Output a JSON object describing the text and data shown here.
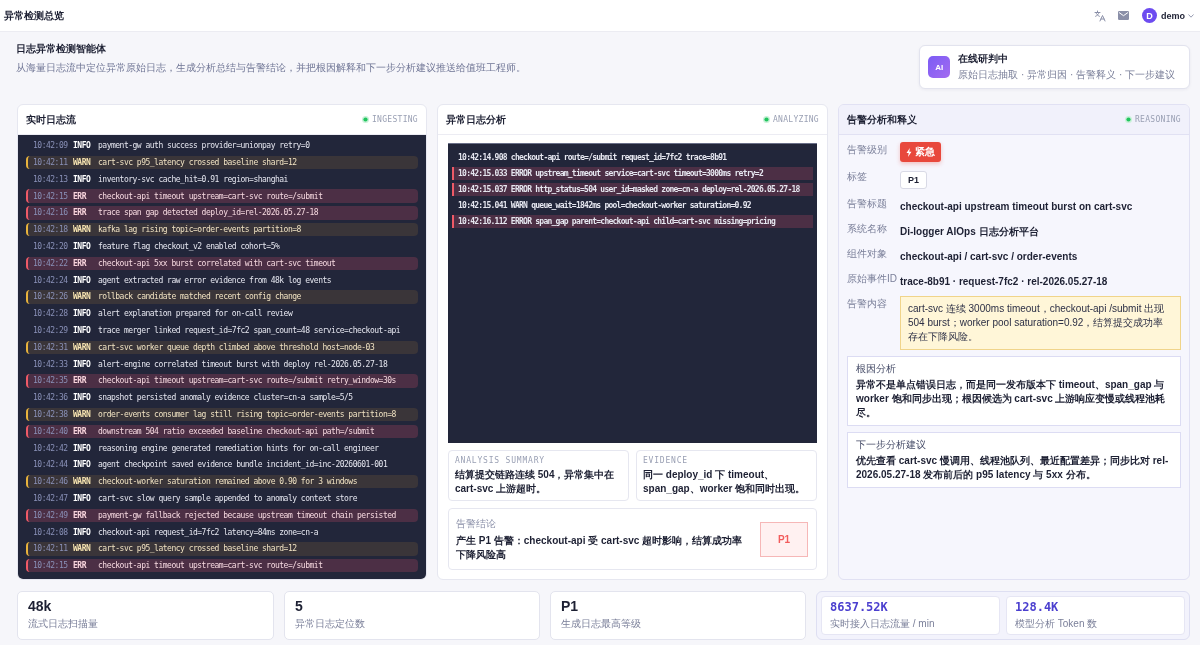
{
  "header": {
    "title": "异常检测总览",
    "user": {
      "initial": "D",
      "name": "demo"
    }
  },
  "intro": {
    "title": "日志异常检测智能体",
    "subtitle": "从海量日志流中定位异常原始日志，生成分析总结与告警结论，并把根因解释和下一步分析建议推送给值班工程师。",
    "agent_card": {
      "badge": "AI",
      "title": "在线研判中",
      "steps": "原始日志抽取 · 异常归因 · 告警释义 · 下一步建议"
    }
  },
  "log_stream": {
    "title": "实时日志流",
    "status": "INGESTING",
    "rows": [
      {
        "time": "10:42:09",
        "level": "INFO",
        "message": "payment-gw auth success provider=unionpay retry=0",
        "kind": "info"
      },
      {
        "time": "10:42:11",
        "level": "WARN",
        "message": "cart-svc p95_latency crossed baseline shard=12",
        "kind": "warn"
      },
      {
        "time": "10:42:13",
        "level": "INFO",
        "message": "inventory-svc cache_hit=0.91 region=shanghai",
        "kind": "info"
      },
      {
        "time": "10:42:15",
        "level": "ERR",
        "message": "checkout-api timeout upstream=cart-svc route=/submit",
        "kind": "err"
      },
      {
        "time": "10:42:16",
        "level": "ERR",
        "message": "trace span gap detected deploy_id=rel-2026.05.27-18",
        "kind": "err"
      },
      {
        "time": "10:42:18",
        "level": "WARN",
        "message": "kafka lag rising topic=order-events partition=8",
        "kind": "warn"
      },
      {
        "time": "10:42:20",
        "level": "INFO",
        "message": "feature flag checkout_v2 enabled cohort=5%",
        "kind": "info"
      },
      {
        "time": "10:42:22",
        "level": "ERR",
        "message": "checkout-api 5xx burst correlated with cart-svc timeout",
        "kind": "err"
      },
      {
        "time": "10:42:24",
        "level": "INFO",
        "message": "agent extracted raw error evidence from 48k log events",
        "kind": "info"
      },
      {
        "time": "10:42:26",
        "level": "WARN",
        "message": "rollback candidate matched recent config change",
        "kind": "warn"
      },
      {
        "time": "10:42:28",
        "level": "INFO",
        "message": "alert explanation prepared for on-call review",
        "kind": "info"
      },
      {
        "time": "10:42:29",
        "level": "INFO",
        "message": "trace merger linked request_id=7fc2 span_count=48 service=checkout-api",
        "kind": "info"
      },
      {
        "time": "10:42:31",
        "level": "WARN",
        "message": "cart-svc worker queue depth climbed above threshold host=node-03",
        "kind": "warn"
      },
      {
        "time": "10:42:33",
        "level": "INFO",
        "message": "alert-engine correlated timeout burst with deploy rel-2026.05.27-18",
        "kind": "info"
      },
      {
        "time": "10:42:35",
        "level": "ERR",
        "message": "checkout-api timeout upstream=cart-svc route=/submit retry_window=30s",
        "kind": "err"
      },
      {
        "time": "10:42:36",
        "level": "INFO",
        "message": "snapshot persisted anomaly evidence cluster=cn-a sample=5/5",
        "kind": "info"
      },
      {
        "time": "10:42:38",
        "level": "WARN",
        "message": "order-events consumer lag still rising topic=order-events partition=8",
        "kind": "warn"
      },
      {
        "time": "10:42:40",
        "level": "ERR",
        "message": "downstream 504 ratio exceeded baseline checkout-api path=/submit",
        "kind": "err"
      },
      {
        "time": "10:42:42",
        "level": "INFO",
        "message": "reasoning engine generated remediation hints for on-call engineer",
        "kind": "info"
      },
      {
        "time": "10:42:44",
        "level": "INFO",
        "message": "agent checkpoint saved evidence bundle incident_id=inc-20260601-001",
        "kind": "info"
      },
      {
        "time": "10:42:46",
        "level": "WARN",
        "message": "checkout-worker saturation remained above 0.90 for 3 windows",
        "kind": "warn"
      },
      {
        "time": "10:42:47",
        "level": "INFO",
        "message": "cart-svc slow query sample appended to anomaly context store",
        "kind": "info"
      },
      {
        "time": "10:42:49",
        "level": "ERR",
        "message": "payment-gw fallback rejected because upstream timeout chain persisted",
        "kind": "err"
      },
      {
        "time": "10:42:08",
        "level": "INFO",
        "message": "checkout-api request_id=7fc2 latency=84ms zone=cn-a",
        "kind": "info"
      },
      {
        "time": "10:42:11",
        "level": "WARN",
        "message": "cart-svc p95_latency crossed baseline shard=12",
        "kind": "warn"
      },
      {
        "time": "10:42:15",
        "level": "ERR",
        "message": "checkout-api timeout upstream=cart-svc route=/submit",
        "kind": "err"
      }
    ]
  },
  "analysis": {
    "title": "异常日志分析",
    "status": "ANALYZING",
    "lines": [
      {
        "text": "10:42:14.908 checkout-api route=/submit request_id=7fc2 trace=8b91",
        "kind": "normal"
      },
      {
        "text": "10:42:15.033 ERROR upstream_timeout service=cart-svc timeout=3000ms retry=2",
        "kind": "error"
      },
      {
        "text": "10:42:15.037 ERROR http_status=504 user_id=masked zone=cn-a deploy=rel-2026.05.27-18",
        "kind": "error"
      },
      {
        "text": "10:42:15.041 WARN queue_wait=1842ms pool=checkout-worker saturation=0.92",
        "kind": "normal"
      },
      {
        "text": "10:42:16.112 ERROR span_gap parent=checkout-api child=cart-svc missing=pricing",
        "kind": "error"
      }
    ],
    "summary": {
      "label": "ANALYSIS SUMMARY",
      "text": "结算提交链路连续 504，异常集中在 cart-svc 上游超时。"
    },
    "evidence": {
      "label": "EVIDENCE",
      "text": "同一 deploy_id 下 timeout、span_gap、worker 饱和同时出现。"
    },
    "conclusion": {
      "label": "告警结论",
      "text": "产生 P1 告警：checkout-api 受 cart-svc 超时影响，结算成功率下降风险高",
      "priority": "P1"
    }
  },
  "explanation": {
    "title": "告警分析和释义",
    "status": "REASONING",
    "fields": [
      {
        "label": "告警级别",
        "kind": "severity",
        "value": "紧急"
      },
      {
        "label": "标签",
        "kind": "tag",
        "value": "P1"
      },
      {
        "label": "告警标题",
        "kind": "text",
        "value": "checkout-api upstream timeout burst on cart-svc"
      },
      {
        "label": "系统名称",
        "kind": "text",
        "value": "Di-logger AIOps 日志分析平台"
      },
      {
        "label": "组件对象",
        "kind": "text",
        "value": "checkout-api / cart-svc / order-events"
      },
      {
        "label": "原始事件ID",
        "kind": "text",
        "value": "trace-8b91 · request-7fc2 · rel-2026.05.27-18"
      },
      {
        "label": "告警内容",
        "kind": "note",
        "value": "cart-svc 连续 3000ms timeout，checkout-api /submit 出现 504 burst；worker pool saturation=0.92，结算提交成功率存在下降风险。"
      }
    ],
    "notes": [
      {
        "title": "根因分析",
        "text": "异常不是单点错误日志，而是同一发布版本下 timeout、span_gap 与 worker 饱和同步出现；根因候选为 cart-svc 上游响应变慢或线程池耗尽。"
      },
      {
        "title": "下一步分析建议",
        "text": "优先查看 cart-svc 慢调用、线程池队列、最近配置差异；同步比对 rel-2026.05.27-18 发布前后的 p95 latency 与 5xx 分布。"
      }
    ]
  },
  "stats": [
    {
      "value": "48k",
      "label": "流式日志扫描量",
      "kind": "plain"
    },
    {
      "value": "5",
      "label": "异常日志定位数",
      "kind": "plain"
    },
    {
      "value": "P1",
      "label": "生成日志最高等级",
      "kind": "plain"
    },
    {
      "value": "8637.52K",
      "label": "实时接入日志流量 / min",
      "kind": "live"
    },
    {
      "value": "128.4K",
      "label": "模型分析 Token 数",
      "kind": "live"
    }
  ]
}
